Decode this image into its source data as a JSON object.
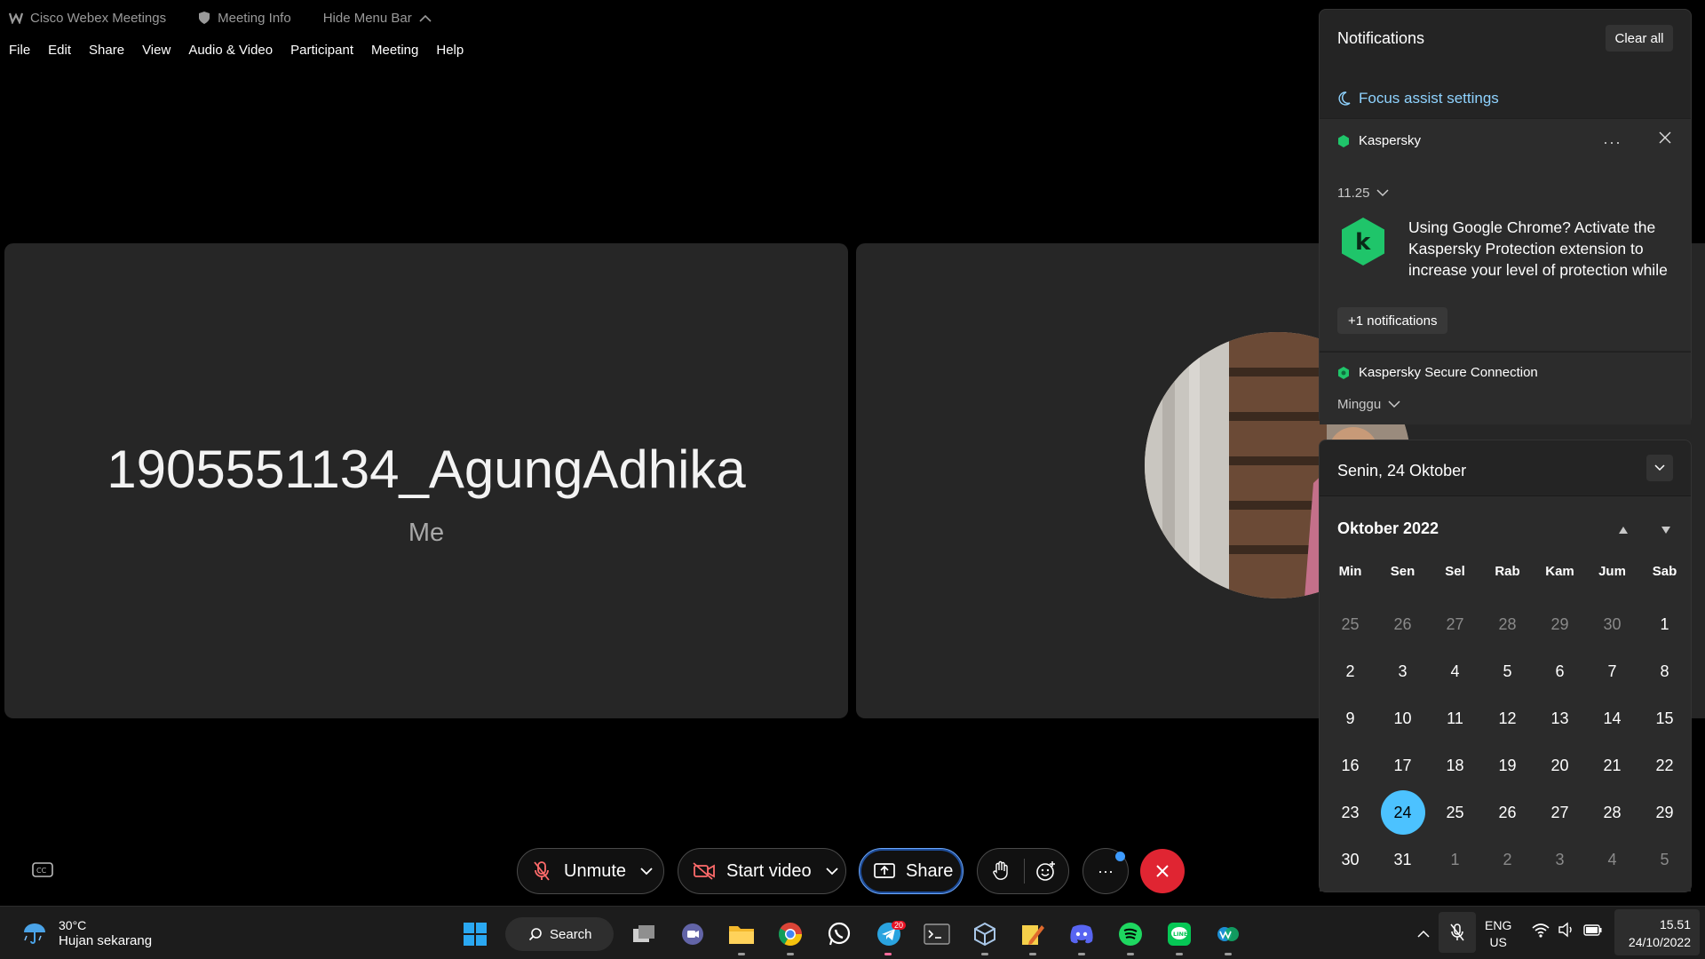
{
  "titlebar": {
    "app_name": "Cisco Webex Meetings",
    "meeting_info": "Meeting Info",
    "hide_menu": "Hide Menu Bar"
  },
  "menubar": [
    "File",
    "Edit",
    "Share",
    "View",
    "Audio & Video",
    "Participant",
    "Meeting",
    "Help"
  ],
  "video": {
    "self_name": "1905551134_AgungAdhika",
    "self_label": "Me"
  },
  "controls": {
    "unmute": "Unmute",
    "start_video": "Start video",
    "share": "Share",
    "more": "···"
  },
  "notifications": {
    "title": "Notifications",
    "clear_all": "Clear all",
    "focus_assist": "Focus assist settings",
    "group1": {
      "app": "Kaspersky",
      "menu": "···",
      "time": "11.25",
      "body": "Using Google Chrome? Activate the Kaspersky Protection extension to increase your level of protection while",
      "more": "+1 notifications"
    },
    "group2": {
      "app": "Kaspersky Secure Connection",
      "time": "Minggu"
    }
  },
  "calendar": {
    "full_date": "Senin, 24 Oktober",
    "month": "Oktober 2022",
    "weekdays": [
      "Min",
      "Sen",
      "Sel",
      "Rab",
      "Kam",
      "Jum",
      "Sab"
    ],
    "weeks": [
      [
        "25",
        "26",
        "27",
        "28",
        "29",
        "30",
        "1"
      ],
      [
        "2",
        "3",
        "4",
        "5",
        "6",
        "7",
        "8"
      ],
      [
        "9",
        "10",
        "11",
        "12",
        "13",
        "14",
        "15"
      ],
      [
        "16",
        "17",
        "18",
        "19",
        "20",
        "21",
        "22"
      ],
      [
        "23",
        "24",
        "25",
        "26",
        "27",
        "28",
        "29"
      ],
      [
        "30",
        "31",
        "1",
        "2",
        "3",
        "4",
        "5"
      ]
    ],
    "selected_day": "24"
  },
  "taskbar": {
    "weather_temp": "30°C",
    "weather_desc": "Hujan sekarang",
    "search": "Search",
    "telegram_badge": "20",
    "lang_top": "ENG",
    "lang_bottom": "US",
    "time": "15.51",
    "date": "24/10/2022"
  },
  "colors": {
    "accent": "#4cc2ff",
    "end_call": "#e02532",
    "kaspersky": "#1fc56a"
  }
}
